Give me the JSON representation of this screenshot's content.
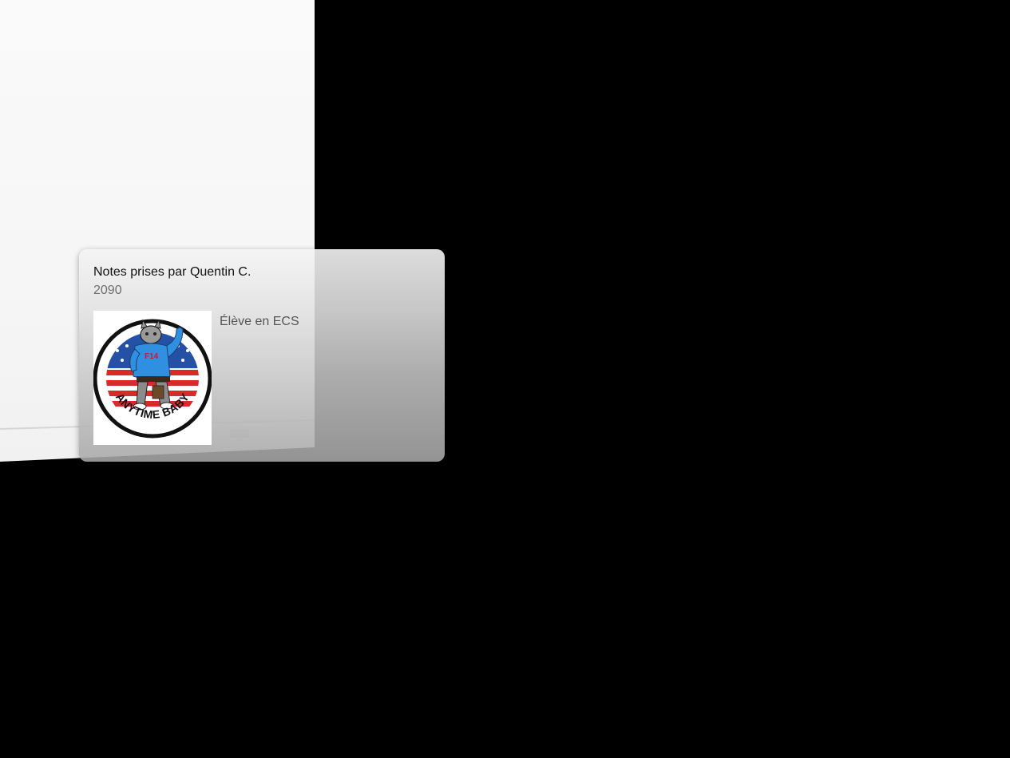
{
  "preview_card": {
    "title": "Notes prises par Quentin C.",
    "subtitle": "2090",
    "description": "Élève en ECS",
    "thumbnail": {
      "icon": "anytime-baby-patch-icon",
      "patch_text": "ANYTIME BABY"
    }
  },
  "colors": {
    "background": "#000000",
    "page": "#f6f6f6",
    "title_text": "#111111",
    "subtitle_text": "#6e6e6e",
    "description_text": "#555555"
  }
}
